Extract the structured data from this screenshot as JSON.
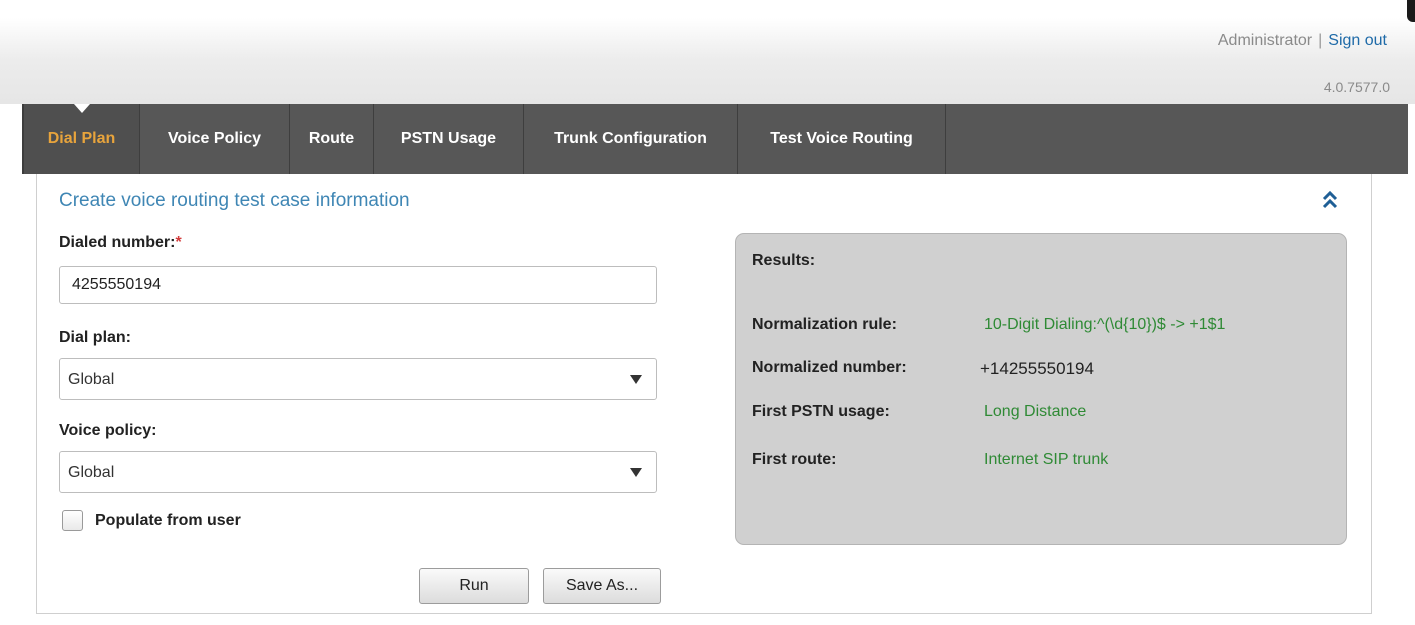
{
  "header": {
    "user": "Administrator",
    "separator": "|",
    "sign_out": "Sign out",
    "version": "4.0.7577.0"
  },
  "nav": {
    "tabs": [
      {
        "label": "Dial Plan",
        "active": true
      },
      {
        "label": "Voice Policy",
        "active": false
      },
      {
        "label": "Route",
        "active": false
      },
      {
        "label": "PSTN Usage",
        "active": false
      },
      {
        "label": "Trunk Configuration",
        "active": false
      },
      {
        "label": "Test Voice Routing",
        "active": false
      }
    ]
  },
  "form": {
    "section_title": "Create voice routing test case information",
    "dialed_number_label": "Dialed number:",
    "required_marker": "*",
    "dialed_number_value": "4255550194",
    "dial_plan_label": "Dial plan:",
    "dial_plan_value": "Global",
    "voice_policy_label": "Voice policy:",
    "voice_policy_value": "Global",
    "populate_label": "Populate from user",
    "populate_checked": false,
    "run_label": "Run",
    "save_as_label": "Save As..."
  },
  "results": {
    "title": "Results:",
    "rows": [
      {
        "label": "Normalization rule:",
        "value": "10-Digit Dialing:^(\\d{10})$ -> +1$1"
      },
      {
        "label": "Normalized number:",
        "value": "+14255550194"
      },
      {
        "label": "First PSTN usage:",
        "value": "Long Distance"
      },
      {
        "label": "First route:",
        "value": "Internet SIP trunk"
      }
    ]
  },
  "colors": {
    "accent_active_tab": "#e8a43c",
    "nav_background": "#575757",
    "link_blue": "#1e6aa8",
    "title_blue": "#3f86b4",
    "result_green": "#2f8a35",
    "required_red": "#d23b3b"
  },
  "icons": {
    "collapse": "double-chevron-up-icon",
    "dropdown": "dropdown-arrow-icon"
  }
}
